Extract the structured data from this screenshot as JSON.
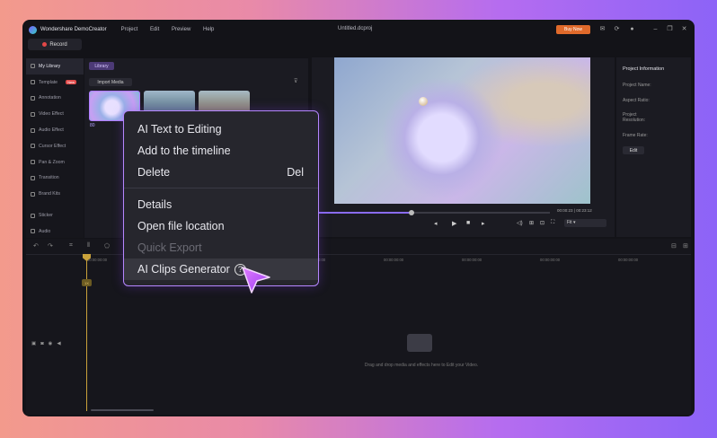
{
  "app": {
    "name": "Wondershare DemoCreator",
    "menu": [
      "Project",
      "Edit",
      "Preview",
      "Help"
    ],
    "document_title": "Untitled.dcproj",
    "buy_now": "Buy Now",
    "record": "Record"
  },
  "sidebar": {
    "items": [
      {
        "label": "My Library",
        "active": true
      },
      {
        "label": "Template",
        "badge": "New"
      },
      {
        "label": "Annotation"
      },
      {
        "label": "Video Effect"
      },
      {
        "label": "Audio Effect"
      },
      {
        "label": "Cursor Effect"
      },
      {
        "label": "Pan & Zoom"
      },
      {
        "label": "Transition"
      },
      {
        "label": "Brand Kits"
      },
      {
        "label": "Sticker"
      },
      {
        "label": "Audio"
      }
    ]
  },
  "library": {
    "tab": "Library",
    "import": "Import Media",
    "first_thumb_label": "80"
  },
  "preview": {
    "timecode_current": "00:00:23",
    "timecode_total": "00:23:12",
    "quality": "Fit"
  },
  "properties": {
    "title": "Project Information",
    "labels": [
      "Project Name:",
      "Aspect Ratio:",
      "Project Resolution:",
      "Frame Rate:"
    ],
    "edit": "Edit"
  },
  "timeline": {
    "ruler": [
      "00:00:00:00",
      "00:00:00:00",
      "00:00:00:00",
      "00:00:00:00",
      "00:00:00:00",
      "00:00:00:00",
      "00:00:00:00"
    ],
    "marker": "1X",
    "empty_text": "Drag and drop media and effects here to Edit your Video."
  },
  "context_menu": {
    "items": [
      {
        "label": "AI Text to Editing"
      },
      {
        "label": "Add to the timeline"
      },
      {
        "label": "Delete",
        "shortcut": "Del"
      },
      {
        "label": "Details"
      },
      {
        "label": "Open file location"
      },
      {
        "label": "Quick Export",
        "disabled": true
      },
      {
        "label": "AI Clips Generator",
        "highlighted": true
      }
    ]
  },
  "colors": {
    "accent": "#b586ff",
    "buy_now": "#e06a2b",
    "playhead": "#c9a23b"
  }
}
